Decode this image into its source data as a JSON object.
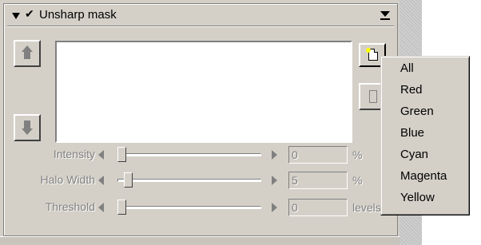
{
  "panel": {
    "title": "Unsharp mask",
    "enabled_check": "✔"
  },
  "sliders": [
    {
      "label": "Intensity",
      "value": "0",
      "unit": "%",
      "level": 0.0
    },
    {
      "label": "Halo Width",
      "value": "5",
      "unit": "%",
      "level": 0.05
    },
    {
      "label": "Threshold",
      "value": "0",
      "unit": "levels",
      "level": 0.0
    }
  ],
  "menu": {
    "items": [
      "All",
      "Red",
      "Green",
      "Blue",
      "Cyan",
      "Magenta",
      "Yellow"
    ]
  },
  "icons": {
    "collapse": "triangle-down-icon",
    "check": "check-icon",
    "panel_menu": "panel-menu-icon",
    "up": "up-arrow-icon",
    "down": "down-arrow-icon",
    "new": "new-document-icon",
    "delete": "trash-icon"
  }
}
